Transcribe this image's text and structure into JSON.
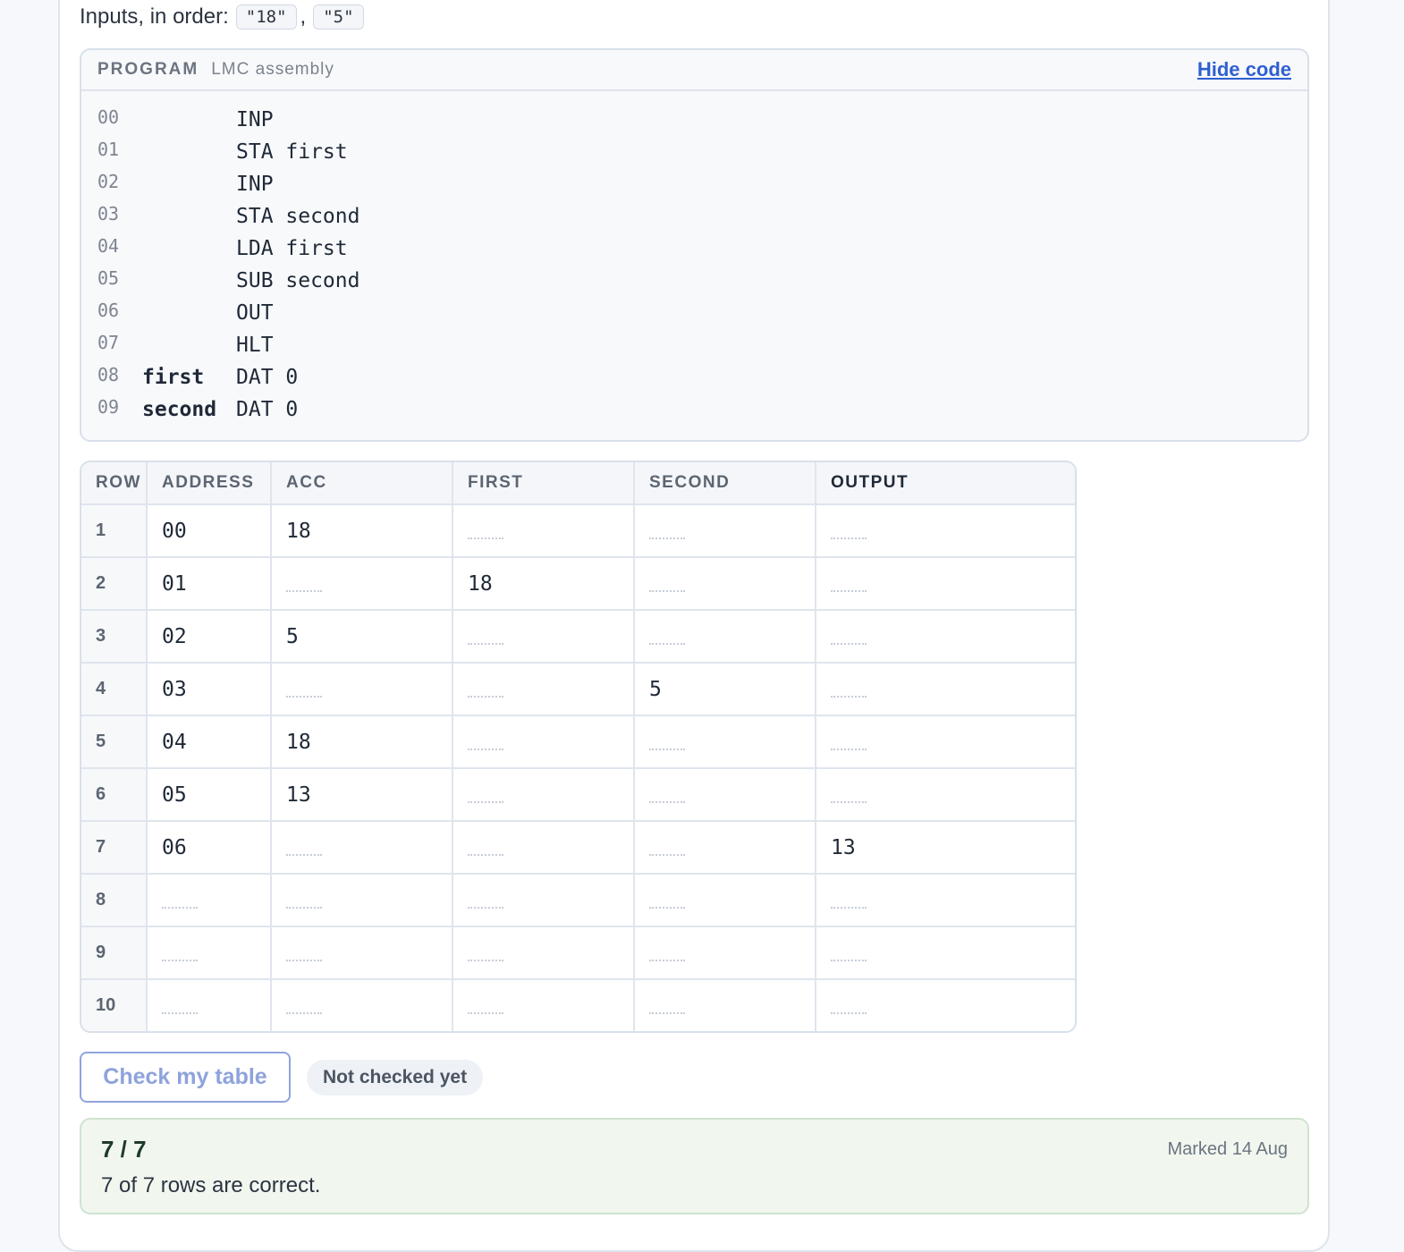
{
  "inputs": {
    "label": "Inputs, in order:",
    "values": [
      "\"18\"",
      "\"5\""
    ],
    "separator": ","
  },
  "program": {
    "title": "PROGRAM",
    "subtitle": "LMC assembly",
    "toggle_label": "Hide code",
    "lines": [
      {
        "num": "00",
        "label": "",
        "instr": "INP"
      },
      {
        "num": "01",
        "label": "",
        "instr": "STA first"
      },
      {
        "num": "02",
        "label": "",
        "instr": "INP"
      },
      {
        "num": "03",
        "label": "",
        "instr": "STA second"
      },
      {
        "num": "04",
        "label": "",
        "instr": "LDA first"
      },
      {
        "num": "05",
        "label": "",
        "instr": "SUB second"
      },
      {
        "num": "06",
        "label": "",
        "instr": "OUT"
      },
      {
        "num": "07",
        "label": "",
        "instr": "HLT"
      },
      {
        "num": "08",
        "label": "first",
        "instr": "DAT 0"
      },
      {
        "num": "09",
        "label": "second",
        "instr": "DAT 0"
      }
    ]
  },
  "trace_table": {
    "headers": [
      "ROW",
      "ADDRESS",
      "ACC",
      "FIRST",
      "SECOND",
      "OUTPUT"
    ],
    "rows": [
      {
        "row": "1",
        "cells": [
          "00",
          "18",
          "",
          "",
          ""
        ]
      },
      {
        "row": "2",
        "cells": [
          "01",
          "",
          "18",
          "",
          ""
        ]
      },
      {
        "row": "3",
        "cells": [
          "02",
          "5",
          "",
          "",
          ""
        ]
      },
      {
        "row": "4",
        "cells": [
          "03",
          "",
          "",
          "5",
          ""
        ]
      },
      {
        "row": "5",
        "cells": [
          "04",
          "18",
          "",
          "",
          ""
        ]
      },
      {
        "row": "6",
        "cells": [
          "05",
          "13",
          "",
          "",
          ""
        ]
      },
      {
        "row": "7",
        "cells": [
          "06",
          "",
          "",
          "",
          "13"
        ]
      },
      {
        "row": "8",
        "cells": [
          "",
          "",
          "",
          "",
          ""
        ]
      },
      {
        "row": "9",
        "cells": [
          "",
          "",
          "",
          "",
          ""
        ]
      },
      {
        "row": "10",
        "cells": [
          "",
          "",
          "",
          "",
          ""
        ]
      }
    ]
  },
  "actions": {
    "check_label": "Check my table",
    "status": "Not checked yet"
  },
  "result": {
    "score": "7 / 7",
    "message": "7 of 7 rows are correct.",
    "marked": "Marked 14 Aug"
  },
  "colors": {
    "accent": "#2f5fd1",
    "success_bg": "#f1f7ef",
    "success_border": "#cfe3cf"
  }
}
